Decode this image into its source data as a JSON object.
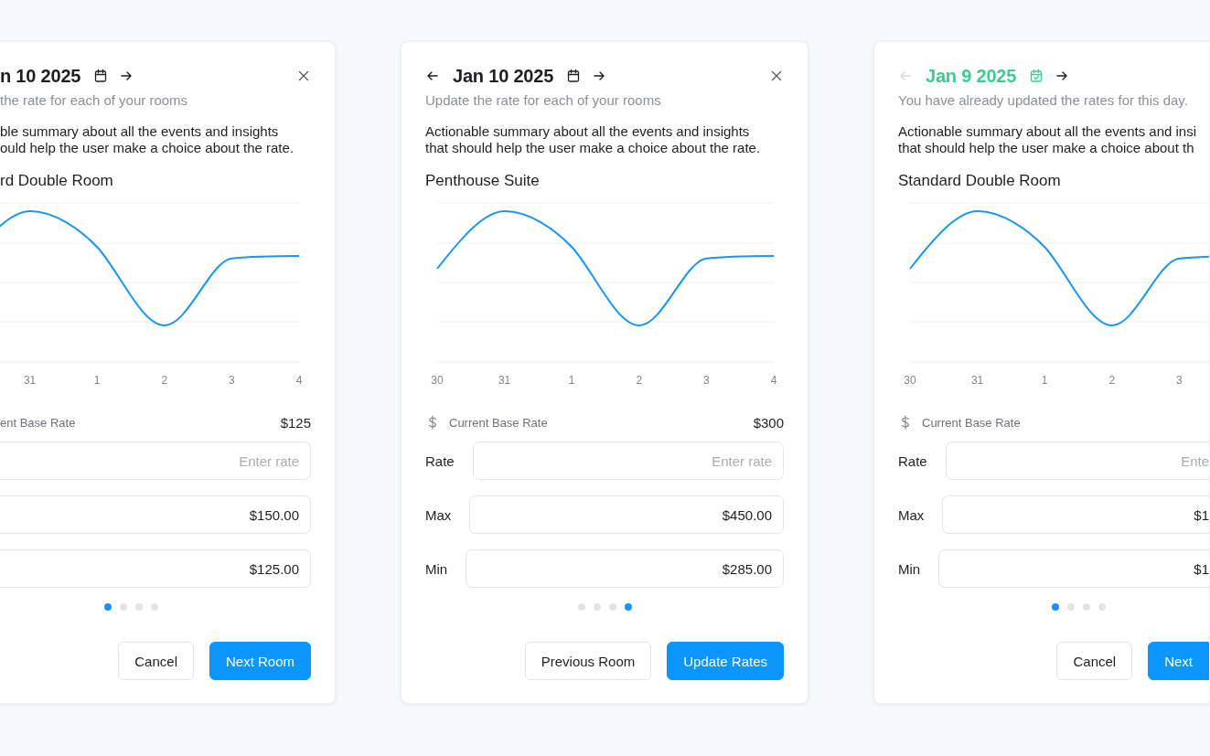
{
  "cards": [
    {
      "title": "n 10 2025",
      "completed": false,
      "next_arrow": {
        "disabled": false
      },
      "close_button": true,
      "subtitle": "the rate for each of your rooms",
      "summary_lines": [
        "ble summary about all the events and insights",
        "ould help the user make a choice about the rate."
      ],
      "room": "rd Double Room",
      "x_labels": [
        "31",
        "1",
        "2",
        "3",
        "4"
      ],
      "base_rate_label": "ent Base Rate",
      "base_rate": "$125",
      "fields": [
        {
          "placeholder": "Enter rate"
        },
        {
          "value": "$150.00"
        },
        {
          "value": "$125.00"
        }
      ],
      "pages": [
        {
          "selected": true
        },
        {
          "selected": false
        },
        {
          "selected": false
        },
        {
          "selected": false
        }
      ],
      "buttons": [
        {
          "label": "Cancel",
          "kind": "secondary"
        },
        {
          "label": "Next Room",
          "kind": "primary"
        }
      ]
    },
    {
      "prev_arrow": {
        "disabled": false
      },
      "title": "Jan 10 2025",
      "completed": false,
      "next_arrow": {
        "disabled": false
      },
      "close_button": true,
      "subtitle": "Update the rate for each of your rooms",
      "summary_lines": [
        "Actionable summary about all the events and insights",
        "that should help the user make a choice about the rate."
      ],
      "room": "Penthouse Suite",
      "x_labels": [
        "30",
        "31",
        "1",
        "2",
        "3",
        "4"
      ],
      "base_rate_label": "Current Base Rate",
      "base_rate": "$300",
      "fields": [
        {
          "label": "Rate",
          "placeholder": "Enter rate"
        },
        {
          "label": "Max",
          "value": "$450.00"
        },
        {
          "label": "Min",
          "value": "$285.00"
        }
      ],
      "pages": [
        {
          "selected": false
        },
        {
          "selected": false
        },
        {
          "selected": false
        },
        {
          "selected": true
        }
      ],
      "buttons": [
        {
          "label": "Previous Room",
          "kind": "secondary"
        },
        {
          "label": "Update Rates",
          "kind": "primary"
        }
      ]
    },
    {
      "prev_arrow": {
        "disabled": true
      },
      "title": "Jan 9 2025",
      "completed": true,
      "next_arrow": {
        "disabled": false
      },
      "close_button": false,
      "subtitle": "You have already updated the rates for this day.",
      "summary_lines": [
        "Actionable summary about all the events and insi",
        "that should help the user make a choice about th"
      ],
      "room": "Standard Double Room",
      "x_labels": [
        "30",
        "31",
        "1",
        "2",
        "3"
      ],
      "base_rate_label": "Current Base Rate",
      "fields": [
        {
          "label": "Rate",
          "placeholder": "Ente"
        },
        {
          "label": "Max",
          "value": "$1"
        },
        {
          "label": "Min",
          "value": "$1"
        }
      ],
      "pages": [
        {
          "selected": true
        },
        {
          "selected": false
        },
        {
          "selected": false
        },
        {
          "selected": false
        }
      ],
      "buttons": [
        {
          "label": "Cancel",
          "kind": "secondary"
        },
        {
          "label": "Next",
          "kind": "primary"
        }
      ]
    }
  ]
}
